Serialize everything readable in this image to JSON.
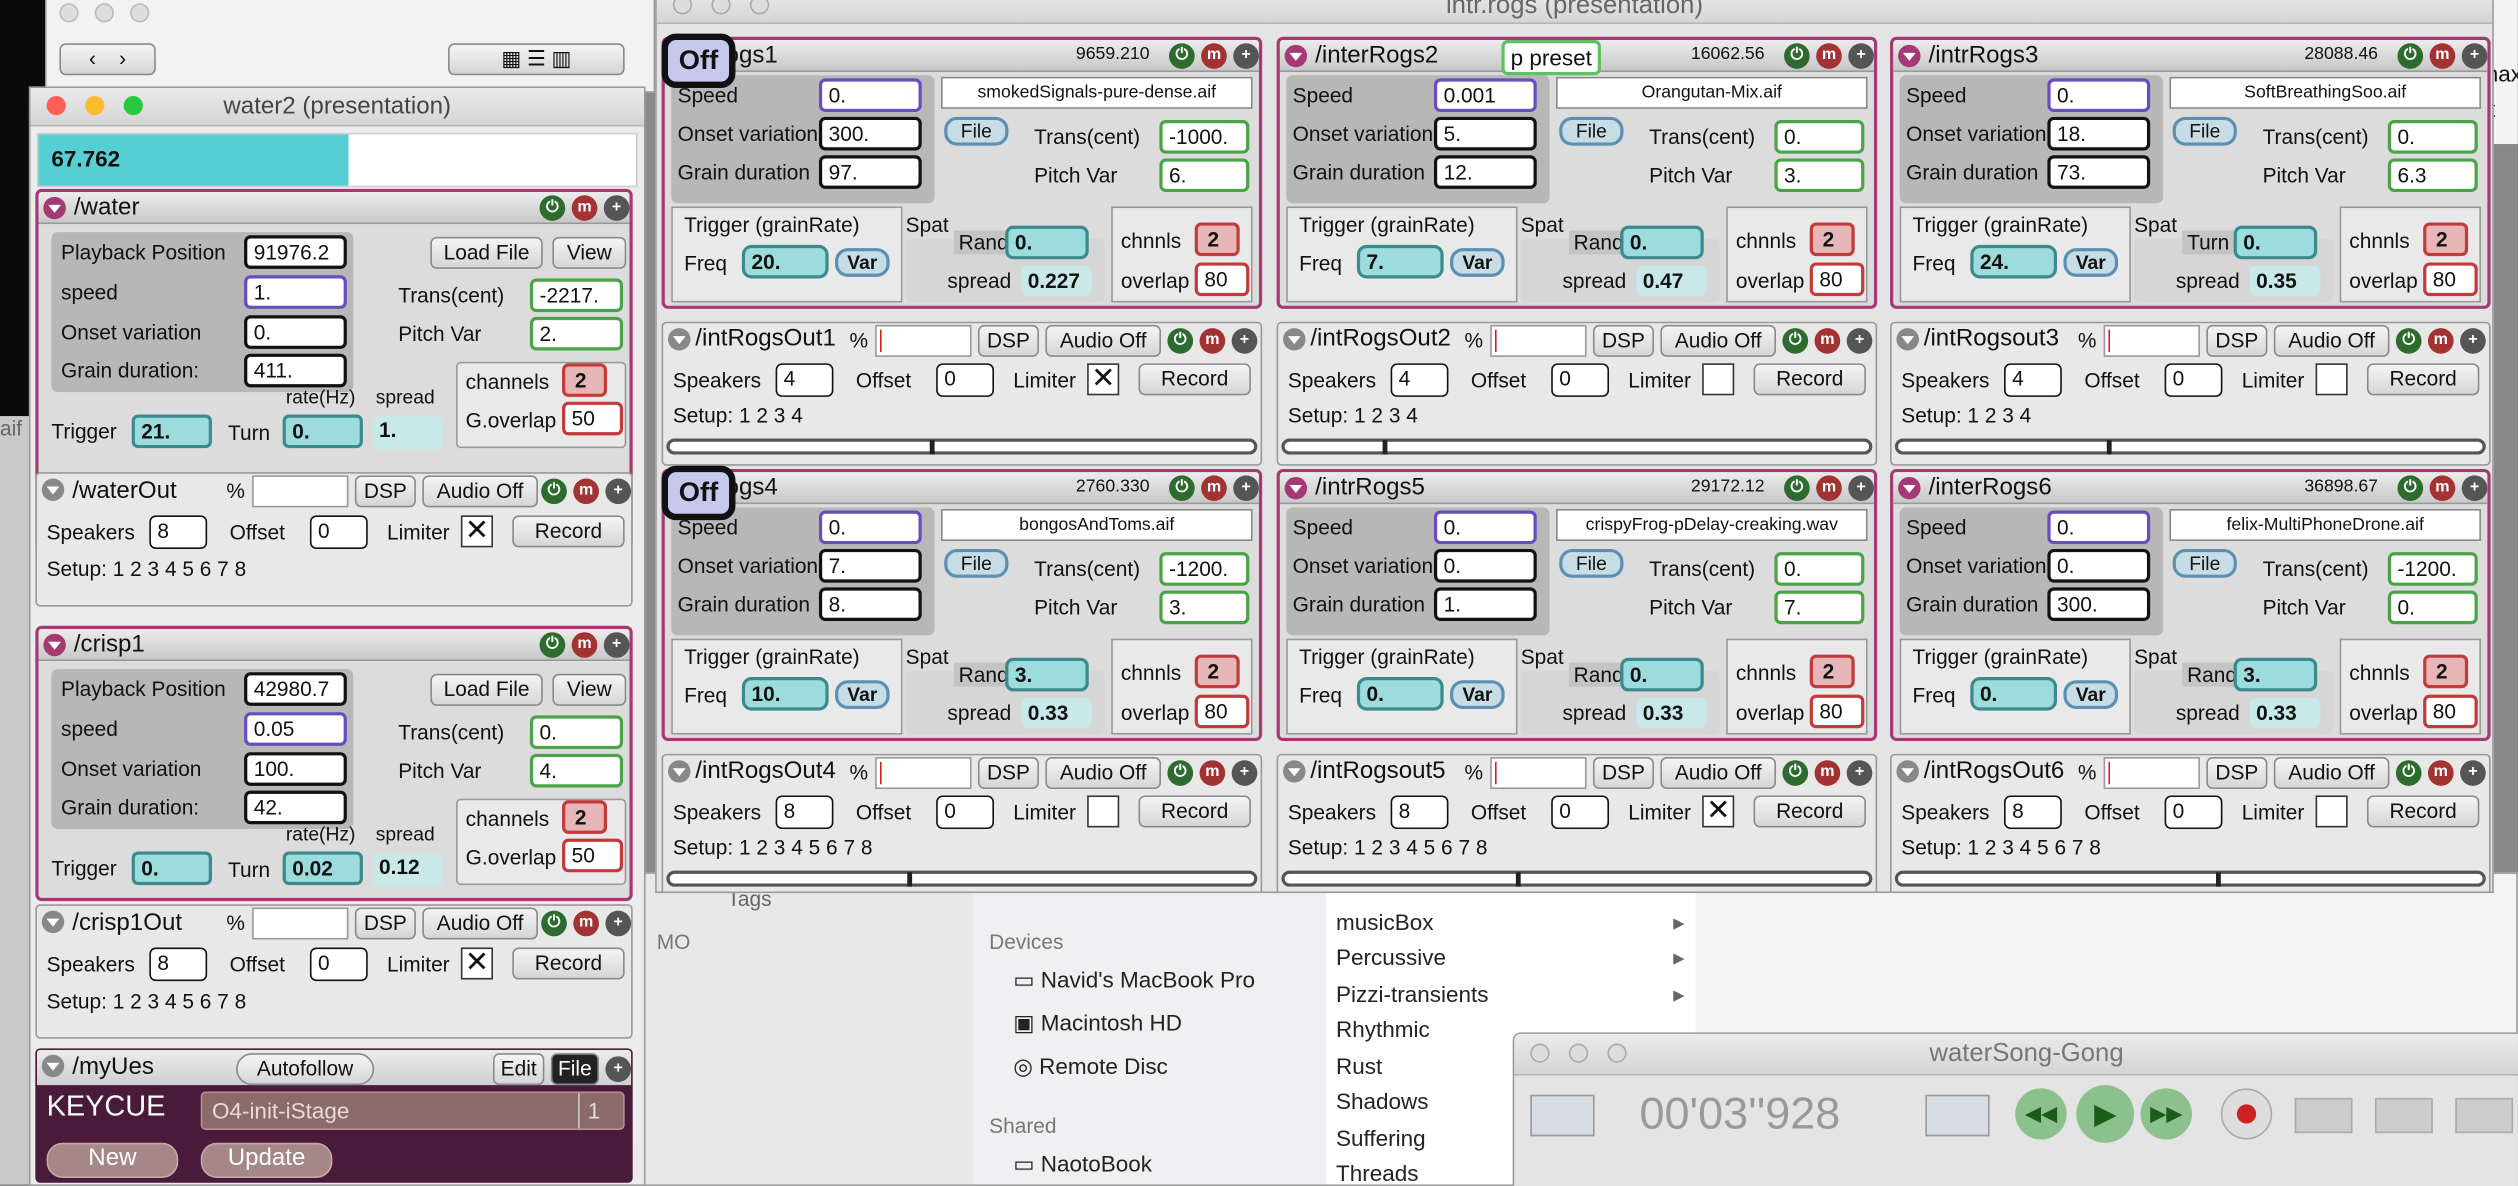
{
  "titles": {
    "interrogs_window": "intr.rogs (presentation)",
    "water2_window": "water2 (presentation)",
    "player_window": "waterSong-Gong",
    "player_time": "00'03''928",
    "tags_label": "Tags"
  },
  "meter": {
    "value": "67.762",
    "fill_fraction": 0.52
  },
  "finder": {
    "devices_header": "Devices",
    "devices": [
      "Navid's MacBook Pro",
      "Macintosh HD",
      "Remote Disc"
    ],
    "shared_header": "Shared",
    "shared": [
      "NaotoBook"
    ],
    "folders": [
      "musicBox",
      "Percussive",
      "Pizzi-transients",
      "Rhythmic",
      "Rust",
      "Shadows",
      "Suffering",
      "Threads"
    ],
    "partial_top": "music",
    "bg_text_1": "aif",
    "bg_text_2": "MO",
    "bg_text_3": "nax",
    "bg_text_4": "t"
  },
  "left": {
    "water": {
      "name": "/water",
      "playback_label": "Playback Position",
      "playback": "91976.2",
      "speed_label": "speed",
      "speed": "1.",
      "onset_label": "Onset variation",
      "onset": "0.",
      "grain_label": "Grain duration:",
      "grain": "411.",
      "load": "Load File",
      "view": "View",
      "trans_label": "Trans(cent)",
      "trans": "-2217.",
      "pitch_label": "Pitch Var",
      "pitch": "2.",
      "trigger_label": "Trigger",
      "trigger": "21.",
      "turn_label": "Turn",
      "rate_label": "rate(Hz)",
      "rate": "0.",
      "spread_label": "spread",
      "spread": "1.",
      "channels_label": "channels",
      "channels": "2",
      "overlap_label": "G.overlap",
      "overlap": "50"
    },
    "waterOut": {
      "name": "/waterOut",
      "pct": "%",
      "dsp": "DSP",
      "audio": "Audio Off",
      "speakers_label": "Speakers",
      "speakers": "8",
      "offset_label": "Offset",
      "offset": "0",
      "limiter_label": "Limiter",
      "limiter": "✕",
      "record": "Record",
      "setup": "Setup: 1 2 3 4 5 6 7 8"
    },
    "crisp1": {
      "name": "/crisp1",
      "playback_label": "Playback Position",
      "playback": "42980.7",
      "speed_label": "speed",
      "speed": "0.05",
      "onset_label": "Onset variation",
      "onset": "100.",
      "grain_label": "Grain duration:",
      "grain": "42.",
      "load": "Load File",
      "view": "View",
      "trans_label": "Trans(cent)",
      "trans": "0.",
      "pitch_label": "Pitch Var",
      "pitch": "4.",
      "trigger_label": "Trigger",
      "trigger": "0.",
      "turn_label": "Turn",
      "rate_label": "rate(Hz)",
      "rate": "0.02",
      "spread_label": "spread",
      "spread": "0.12",
      "channels_label": "channels",
      "channels": "2",
      "overlap_label": "G.overlap",
      "overlap": "50"
    },
    "crisp1Out": {
      "name": "/crisp1Out",
      "pct": "%",
      "dsp": "DSP",
      "audio": "Audio Off",
      "speakers_label": "Speakers",
      "speakers": "8",
      "offset_label": "Offset",
      "offset": "0",
      "limiter_label": "Limiter",
      "limiter": "✕",
      "record": "Record",
      "setup": "Setup: 1 2 3 4 5 6 7 8"
    },
    "myUes": {
      "name": "/myUes",
      "autofollow": "Autofollow",
      "edit": "Edit",
      "file": "File",
      "keycue": "KEYCUE",
      "cue": "O4-init-iStage",
      "cue_num": "1",
      "new": "New",
      "update": "Update"
    }
  },
  "labels": {
    "speed": "Speed",
    "onset": "Onset variation",
    "grain": "Grain duration",
    "file": "File",
    "trans": "Trans(cent)",
    "pitch": "Pitch Var",
    "trigger": "Trigger (grainRate)",
    "freq": "Freq",
    "var": "Var",
    "spat": "Spat",
    "chnnls": "chnnls",
    "spread": "spread",
    "overlap": "overlap",
    "speakers": "Speakers",
    "offset": "Offset",
    "limiter": "Limiter",
    "record": "Record",
    "dsp": "DSP",
    "audio": "Audio Off",
    "pct": "%",
    "off": "Off",
    "preset": "p preset"
  },
  "grains": [
    {
      "name": "rRogs1",
      "value": "9659.210",
      "speed": "0.",
      "onset": "300.",
      "grain": "97.",
      "file": "smokedSignals-pure-dense.aif",
      "trans": "-1000.",
      "pitch": "6.",
      "freq": "20.",
      "spat_mode": "Rand",
      "spat": "0.",
      "spread": "0.227",
      "chnnls": "2",
      "overlap": "80",
      "out_name": "/intRogsOut1",
      "speakers": "4",
      "offset": "0",
      "limiter": "✕",
      "setup": "Setup: 1 2 3 4",
      "slider": 0.45
    },
    {
      "name": "/interRogs2",
      "value": "16062.56",
      "speed": "0.001",
      "onset": "5.",
      "grain": "12.",
      "file": "Orangutan-Mix.aif",
      "trans": "0.",
      "pitch": "3.",
      "freq": "7.",
      "spat_mode": "Rand",
      "spat": "0.",
      "spread": "0.47",
      "chnnls": "2",
      "overlap": "80",
      "out_name": "/intRogsOut2",
      "speakers": "4",
      "offset": "0",
      "limiter": "",
      "setup": "Setup: 1 2 3 4",
      "slider": 0.17
    },
    {
      "name": "/intrRogs3",
      "value": "28088.46",
      "speed": "0.",
      "onset": "18.",
      "grain": "73.",
      "file": "SoftBreathingSoo.aif",
      "trans": "0.",
      "pitch": "6.3",
      "freq": "24.",
      "spat_mode": "Turn",
      "spat": "0.",
      "spread": "0.35",
      "chnnls": "2",
      "overlap": "80",
      "out_name": "/intRogsout3",
      "speakers": "4",
      "offset": "0",
      "limiter": "",
      "setup": "Setup: 1 2 3 4",
      "slider": 0.36
    },
    {
      "name": "rRogs4",
      "value": "2760.330",
      "speed": "0.",
      "onset": "7.",
      "grain": "8.",
      "file": "bongosAndToms.aif",
      "trans": "-1200.",
      "pitch": "3.",
      "freq": "10.",
      "spat_mode": "Rand",
      "spat": "3.",
      "spread": "0.33",
      "chnnls": "2",
      "overlap": "80",
      "out_name": "/intRogsOut4",
      "speakers": "8",
      "offset": "0",
      "limiter": "",
      "setup": "Setup: 1 2 3 4 5 6 7 8",
      "slider": 0.41
    },
    {
      "name": "/intrRogs5",
      "value": "29172.12",
      "speed": "0.",
      "onset": "0.",
      "grain": "1.",
      "file": "crispyFrog-pDelay-creaking.wav",
      "trans": "0.",
      "pitch": "7.",
      "freq": "0.",
      "spat_mode": "Rand",
      "spat": "0.",
      "spread": "0.33",
      "chnnls": "2",
      "overlap": "80",
      "out_name": "/intRogsout5",
      "speakers": "8",
      "offset": "0",
      "limiter": "✕",
      "setup": "Setup: 1 2 3 4 5 6 7 8",
      "slider": 0.4
    },
    {
      "name": "/interRogs6",
      "value": "36898.67",
      "speed": "0.",
      "onset": "0.",
      "grain": "300.",
      "file": "felix-MultiPhoneDrone.aif",
      "trans": "-1200.",
      "pitch": "0.",
      "freq": "0.",
      "spat_mode": "Rand",
      "spat": "3.",
      "spread": "0.33",
      "chnnls": "2",
      "overlap": "80",
      "out_name": "/intRogsOut6",
      "speakers": "8",
      "offset": "0",
      "limiter": "",
      "setup": "Setup: 1 2 3 4 5 6 7 8",
      "slider": 0.55
    }
  ]
}
